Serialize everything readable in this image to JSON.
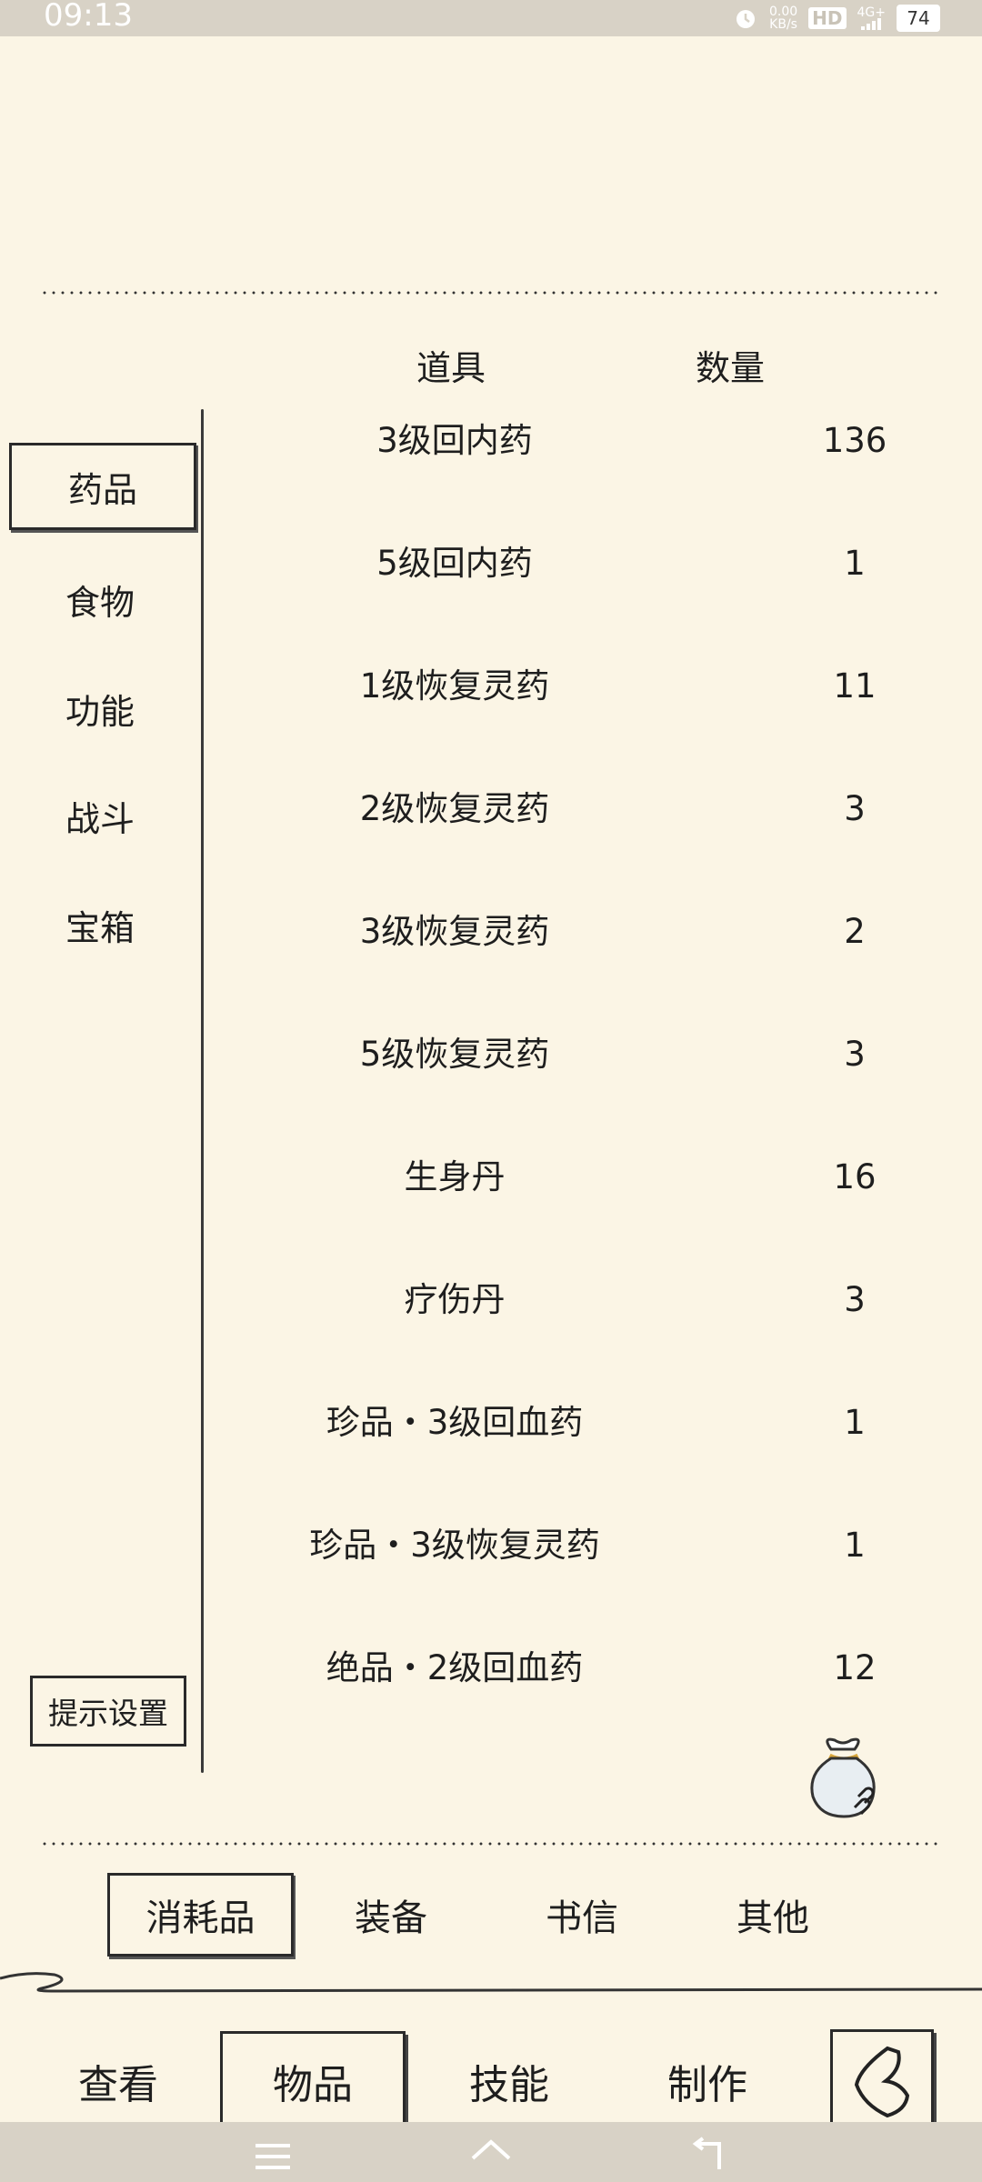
{
  "status_bar": {
    "time": "09:13",
    "net_speed_value": "0.00",
    "net_speed_unit": "KB/s",
    "hd": "HD",
    "network": "4G+",
    "battery": "74"
  },
  "table": {
    "headers": {
      "item": "道具",
      "quantity": "数量"
    },
    "rows": [
      {
        "name": "3级回内药",
        "qty": "136"
      },
      {
        "name": "5级回内药",
        "qty": "1"
      },
      {
        "name": "1级恢复灵药",
        "qty": "11"
      },
      {
        "name": "2级恢复灵药",
        "qty": "3"
      },
      {
        "name": "3级恢复灵药",
        "qty": "2"
      },
      {
        "name": "5级恢复灵药",
        "qty": "3"
      },
      {
        "name": "生身丹",
        "qty": "16"
      },
      {
        "name": "疗伤丹",
        "qty": "3"
      },
      {
        "name": "珍品・3级回血药",
        "qty": "1"
      },
      {
        "name": "珍品・3级恢复灵药",
        "qty": "1"
      },
      {
        "name": "绝品・2级回血药",
        "qty": "12"
      }
    ]
  },
  "categories": {
    "items": [
      "药品",
      "食物",
      "功能",
      "战斗",
      "宝箱"
    ],
    "selected": "药品"
  },
  "hint_settings_label": "提示设置",
  "sub_tabs": {
    "items": [
      "消耗品",
      "装备",
      "书信",
      "其他"
    ],
    "selected": "消耗品"
  },
  "main_tabs": {
    "items": [
      "查看",
      "物品",
      "技能",
      "制作"
    ],
    "selected": "物品"
  },
  "icons": {
    "bag": "item-bag-icon",
    "back": "back-arrow-icon",
    "alarm": "alarm-icon",
    "nav_menu": "menu-icon",
    "nav_home": "home-icon",
    "nav_back": "back-icon"
  },
  "colors": {
    "background": "#fbf5e5",
    "ink": "#1e1e1e",
    "system_bar": "#d8d2c6"
  }
}
